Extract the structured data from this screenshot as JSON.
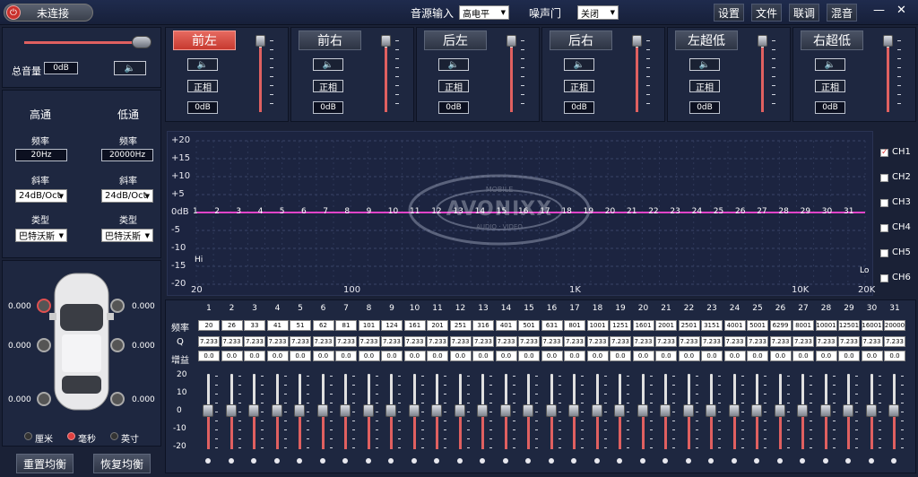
{
  "topbar": {
    "connection": "未连接",
    "source_label": "音源输入",
    "source_value": "高电平",
    "noise_label": "噪声门",
    "noise_value": "关闭",
    "buttons": [
      "设置",
      "文件",
      "联调",
      "混音"
    ],
    "min_symbol": "—",
    "close_symbol": "✕"
  },
  "master": {
    "label": "总音量",
    "value": "0dB",
    "level": 0.95
  },
  "crossover": {
    "high": {
      "title": "高通",
      "freq_label": "频率",
      "freq": "20Hz",
      "slope_label": "斜率",
      "slope": "24dB/Oct",
      "type_label": "类型",
      "type": "巴特沃斯"
    },
    "low": {
      "title": "低通",
      "freq_label": "频率",
      "freq": "20000Hz",
      "slope_label": "斜率",
      "slope": "24dB/Oct",
      "type_label": "类型",
      "type": "巴特沃斯"
    }
  },
  "delay": {
    "values": [
      "0.000",
      "0.000",
      "0.000",
      "0.000",
      "0.000",
      "0.000"
    ],
    "units": [
      "厘米",
      "毫秒",
      "英寸"
    ],
    "selected_unit": 1
  },
  "bottom_buttons": [
    "重置均衡",
    "恢复均衡"
  ],
  "channels": [
    {
      "name": "前左",
      "phase": "正相",
      "gain": "0dB",
      "active": true
    },
    {
      "name": "前右",
      "phase": "正相",
      "gain": "0dB",
      "active": false
    },
    {
      "name": "后左",
      "phase": "正相",
      "gain": "0dB",
      "active": false
    },
    {
      "name": "后右",
      "phase": "正相",
      "gain": "0dB",
      "active": false
    },
    {
      "name": "左超低",
      "phase": "正相",
      "gain": "0dB",
      "active": false
    },
    {
      "name": "右超低",
      "phase": "正相",
      "gain": "0dB",
      "active": false
    }
  ],
  "graph": {
    "ylabels": [
      "+20",
      "+15",
      "+10",
      "+5",
      "0dB",
      "-5",
      "-10",
      "-15",
      "-20"
    ],
    "xlabels": [
      "20",
      "100",
      "1K",
      "10K",
      "20K"
    ],
    "hi": "Hi",
    "lo": "Lo",
    "points": [
      "1",
      "2",
      "3",
      "4",
      "5",
      "6",
      "7",
      "8",
      "9",
      "10",
      "11",
      "12",
      "13",
      "14",
      "15",
      "16",
      "17",
      "18",
      "19",
      "20",
      "21",
      "22",
      "23",
      "24",
      "25",
      "26",
      "27",
      "28",
      "29",
      "30",
      "31"
    ],
    "logo_top": "MOBILE",
    "logo_main": "AVONIXX",
    "logo_sub": "AUDIO · VIDEO",
    "ch_list": [
      "CH1",
      "CH2",
      "CH3",
      "CH4",
      "CH5",
      "CH6"
    ],
    "ch_checked": 0
  },
  "eq": {
    "row_labels": [
      "频率",
      "Q",
      "增益"
    ],
    "bands": [
      "1",
      "2",
      "3",
      "4",
      "5",
      "6",
      "7",
      "8",
      "9",
      "10",
      "11",
      "12",
      "13",
      "14",
      "15",
      "16",
      "17",
      "18",
      "19",
      "20",
      "21",
      "22",
      "23",
      "24",
      "25",
      "26",
      "27",
      "28",
      "29",
      "30",
      "31"
    ],
    "freqs": [
      "20",
      "26",
      "33",
      "41",
      "51",
      "62",
      "81",
      "101",
      "124",
      "161",
      "201",
      "251",
      "316",
      "401",
      "501",
      "631",
      "801",
      "1001",
      "1251",
      "1601",
      "2001",
      "2501",
      "3151",
      "4001",
      "5001",
      "6299",
      "8001",
      "10001",
      "12501",
      "16001",
      "20000"
    ],
    "q": "7.233",
    "gain": "0.0",
    "scale": [
      "20",
      "10",
      "0",
      "-10",
      "-20"
    ]
  }
}
